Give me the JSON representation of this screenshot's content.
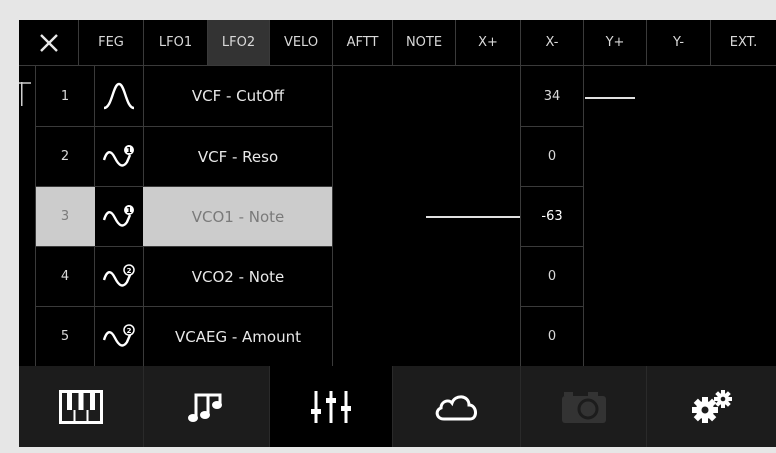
{
  "header": {
    "close_icon": "close-x-icon",
    "tabs": [
      {
        "label": "FEG",
        "active": false
      },
      {
        "label": "LFO1",
        "active": false
      },
      {
        "label": "LFO2",
        "active": true
      },
      {
        "label": "VELO",
        "active": false
      },
      {
        "label": "AFTT",
        "active": false
      },
      {
        "label": "NOTE",
        "active": false
      },
      {
        "label": "X+",
        "active": false
      },
      {
        "label": "X-",
        "active": false
      },
      {
        "label": "Y+",
        "active": false
      },
      {
        "label": "Y-",
        "active": false
      },
      {
        "label": "EXT.",
        "active": false
      }
    ]
  },
  "rows": [
    {
      "num": "1",
      "icon": "envelope-curve-icon",
      "dest": "VCF - CutOff",
      "value": "34",
      "selected": false
    },
    {
      "num": "2",
      "icon": "sine-wave-1-icon",
      "dest": "VCF - Reso",
      "value": "0",
      "selected": false
    },
    {
      "num": "3",
      "icon": "sine-wave-1-icon",
      "dest": "VCO1 - Note",
      "value": "-63",
      "selected": true
    },
    {
      "num": "4",
      "icon": "sine-wave-2-icon",
      "dest": "VCO2 - Note",
      "value": "0",
      "selected": false
    },
    {
      "num": "5",
      "icon": "sine-wave-2-icon",
      "dest": "VCAEG - Amount",
      "value": "0",
      "selected": false
    }
  ],
  "bottom_nav": [
    {
      "icon": "piano-keys-icon",
      "active": false
    },
    {
      "icon": "music-note-icon",
      "active": false
    },
    {
      "icon": "sliders-icon",
      "active": true
    },
    {
      "icon": "cloud-icon",
      "active": false
    },
    {
      "icon": "camera-icon",
      "active": false,
      "disabled": true
    },
    {
      "icon": "gears-icon",
      "active": false
    }
  ],
  "colors": {
    "background": "#000000",
    "selected_row": "#cccccc",
    "active_tab": "#333333",
    "text": "#d9d9d9"
  }
}
